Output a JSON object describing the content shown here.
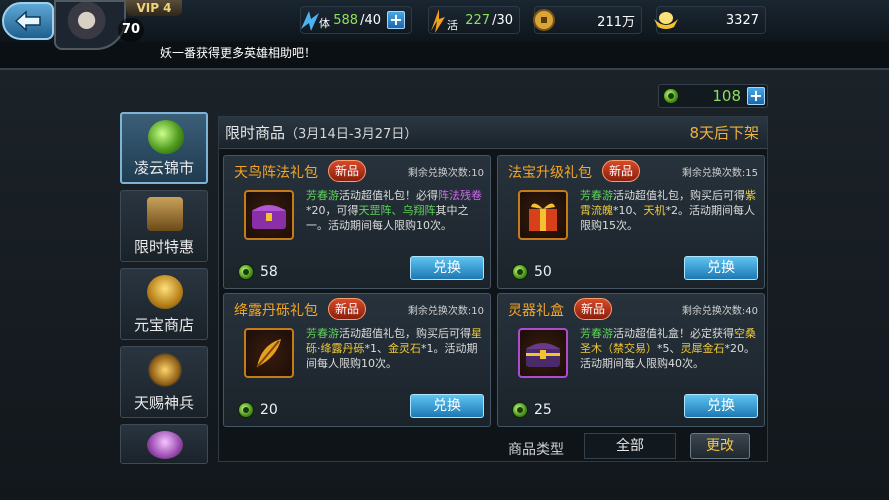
{
  "header": {
    "vip": "VIP 4",
    "level": "70",
    "stamina": {
      "icon": "stamina-icon",
      "label": "体",
      "value": "588",
      "max": "/40"
    },
    "vigor": {
      "icon": "vigor-icon",
      "label": "活",
      "value": "227",
      "max": "/30"
    },
    "coins": {
      "icon": "coin-icon",
      "value": "211万"
    },
    "ingots": {
      "icon": "ingot-icon",
      "value": "3327"
    }
  },
  "marquee": "妖一番获得更多英雄相助吧！",
  "gem_balance": "108",
  "sidebar": {
    "items": [
      {
        "label": "凌云锦市",
        "icon": "jade-coin-icon"
      },
      {
        "label": "限时特惠",
        "icon": "hourglass-icon"
      },
      {
        "label": "元宝商店",
        "icon": "treasure-pot-icon"
      },
      {
        "label": "天赐神兵",
        "icon": "weapons-icon"
      },
      {
        "label": "",
        "icon": "pot-icon"
      }
    ]
  },
  "shop": {
    "title": "限时商品",
    "date_range": "（3月14日-3月27日）",
    "countdown": "8天后下架",
    "new_badge": "新品",
    "exchange_label": "兑换",
    "cards": [
      {
        "name": "天鸟阵法礼包",
        "remain": "剩余兑换次数:10",
        "price": "58",
        "item_icon": "purple-chest-icon",
        "desc": [
          {
            "t": "芳春游",
            "c": "g"
          },
          {
            "t": "活动超值礼包！必得",
            "c": ""
          },
          {
            "t": "阵法残卷",
            "c": "p"
          },
          {
            "t": "*20，可得",
            "c": ""
          },
          {
            "t": "天罡阵、乌翔阵",
            "c": "g"
          },
          {
            "t": "其中之一。活动期间每人限购10次。",
            "c": ""
          }
        ]
      },
      {
        "name": "法宝升级礼包",
        "remain": "剩余兑换次数:15",
        "price": "50",
        "item_icon": "gift-box-icon",
        "desc": [
          {
            "t": "芳春游",
            "c": "g"
          },
          {
            "t": "活动超值礼包，购买后可得",
            "c": ""
          },
          {
            "t": "紫霄流魄",
            "c": "y"
          },
          {
            "t": "*10、",
            "c": ""
          },
          {
            "t": "天机",
            "c": "y"
          },
          {
            "t": "*2。活动期间每人限购15次。",
            "c": ""
          }
        ]
      },
      {
        "name": "绛露丹砾礼包",
        "remain": "剩余兑换次数:10",
        "price": "20",
        "item_icon": "feather-icon",
        "desc": [
          {
            "t": "芳春游",
            "c": "g"
          },
          {
            "t": "活动超值礼包，购买后可得",
            "c": ""
          },
          {
            "t": "星砾",
            "c": "y"
          },
          {
            "t": "·",
            "c": ""
          },
          {
            "t": "绛露丹砾",
            "c": "y"
          },
          {
            "t": "*1、",
            "c": ""
          },
          {
            "t": "金灵石",
            "c": "y"
          },
          {
            "t": "*1。活动期间每人限购10次。",
            "c": ""
          }
        ]
      },
      {
        "name": "灵器礼盒",
        "remain": "剩余兑换次数:40",
        "price": "25",
        "item_icon": "gold-chest-icon",
        "desc": [
          {
            "t": "芳春游",
            "c": "g"
          },
          {
            "t": "活动超值礼盒！必定获得",
            "c": ""
          },
          {
            "t": "空桑圣木（禁交易）",
            "c": "y"
          },
          {
            "t": "*5、",
            "c": ""
          },
          {
            "t": "灵犀金石",
            "c": "y"
          },
          {
            "t": "*20。活动期间每人限购40次。",
            "c": ""
          }
        ]
      }
    ]
  },
  "filter": {
    "label": "商品类型",
    "value": "全部",
    "change_label": "更改"
  }
}
